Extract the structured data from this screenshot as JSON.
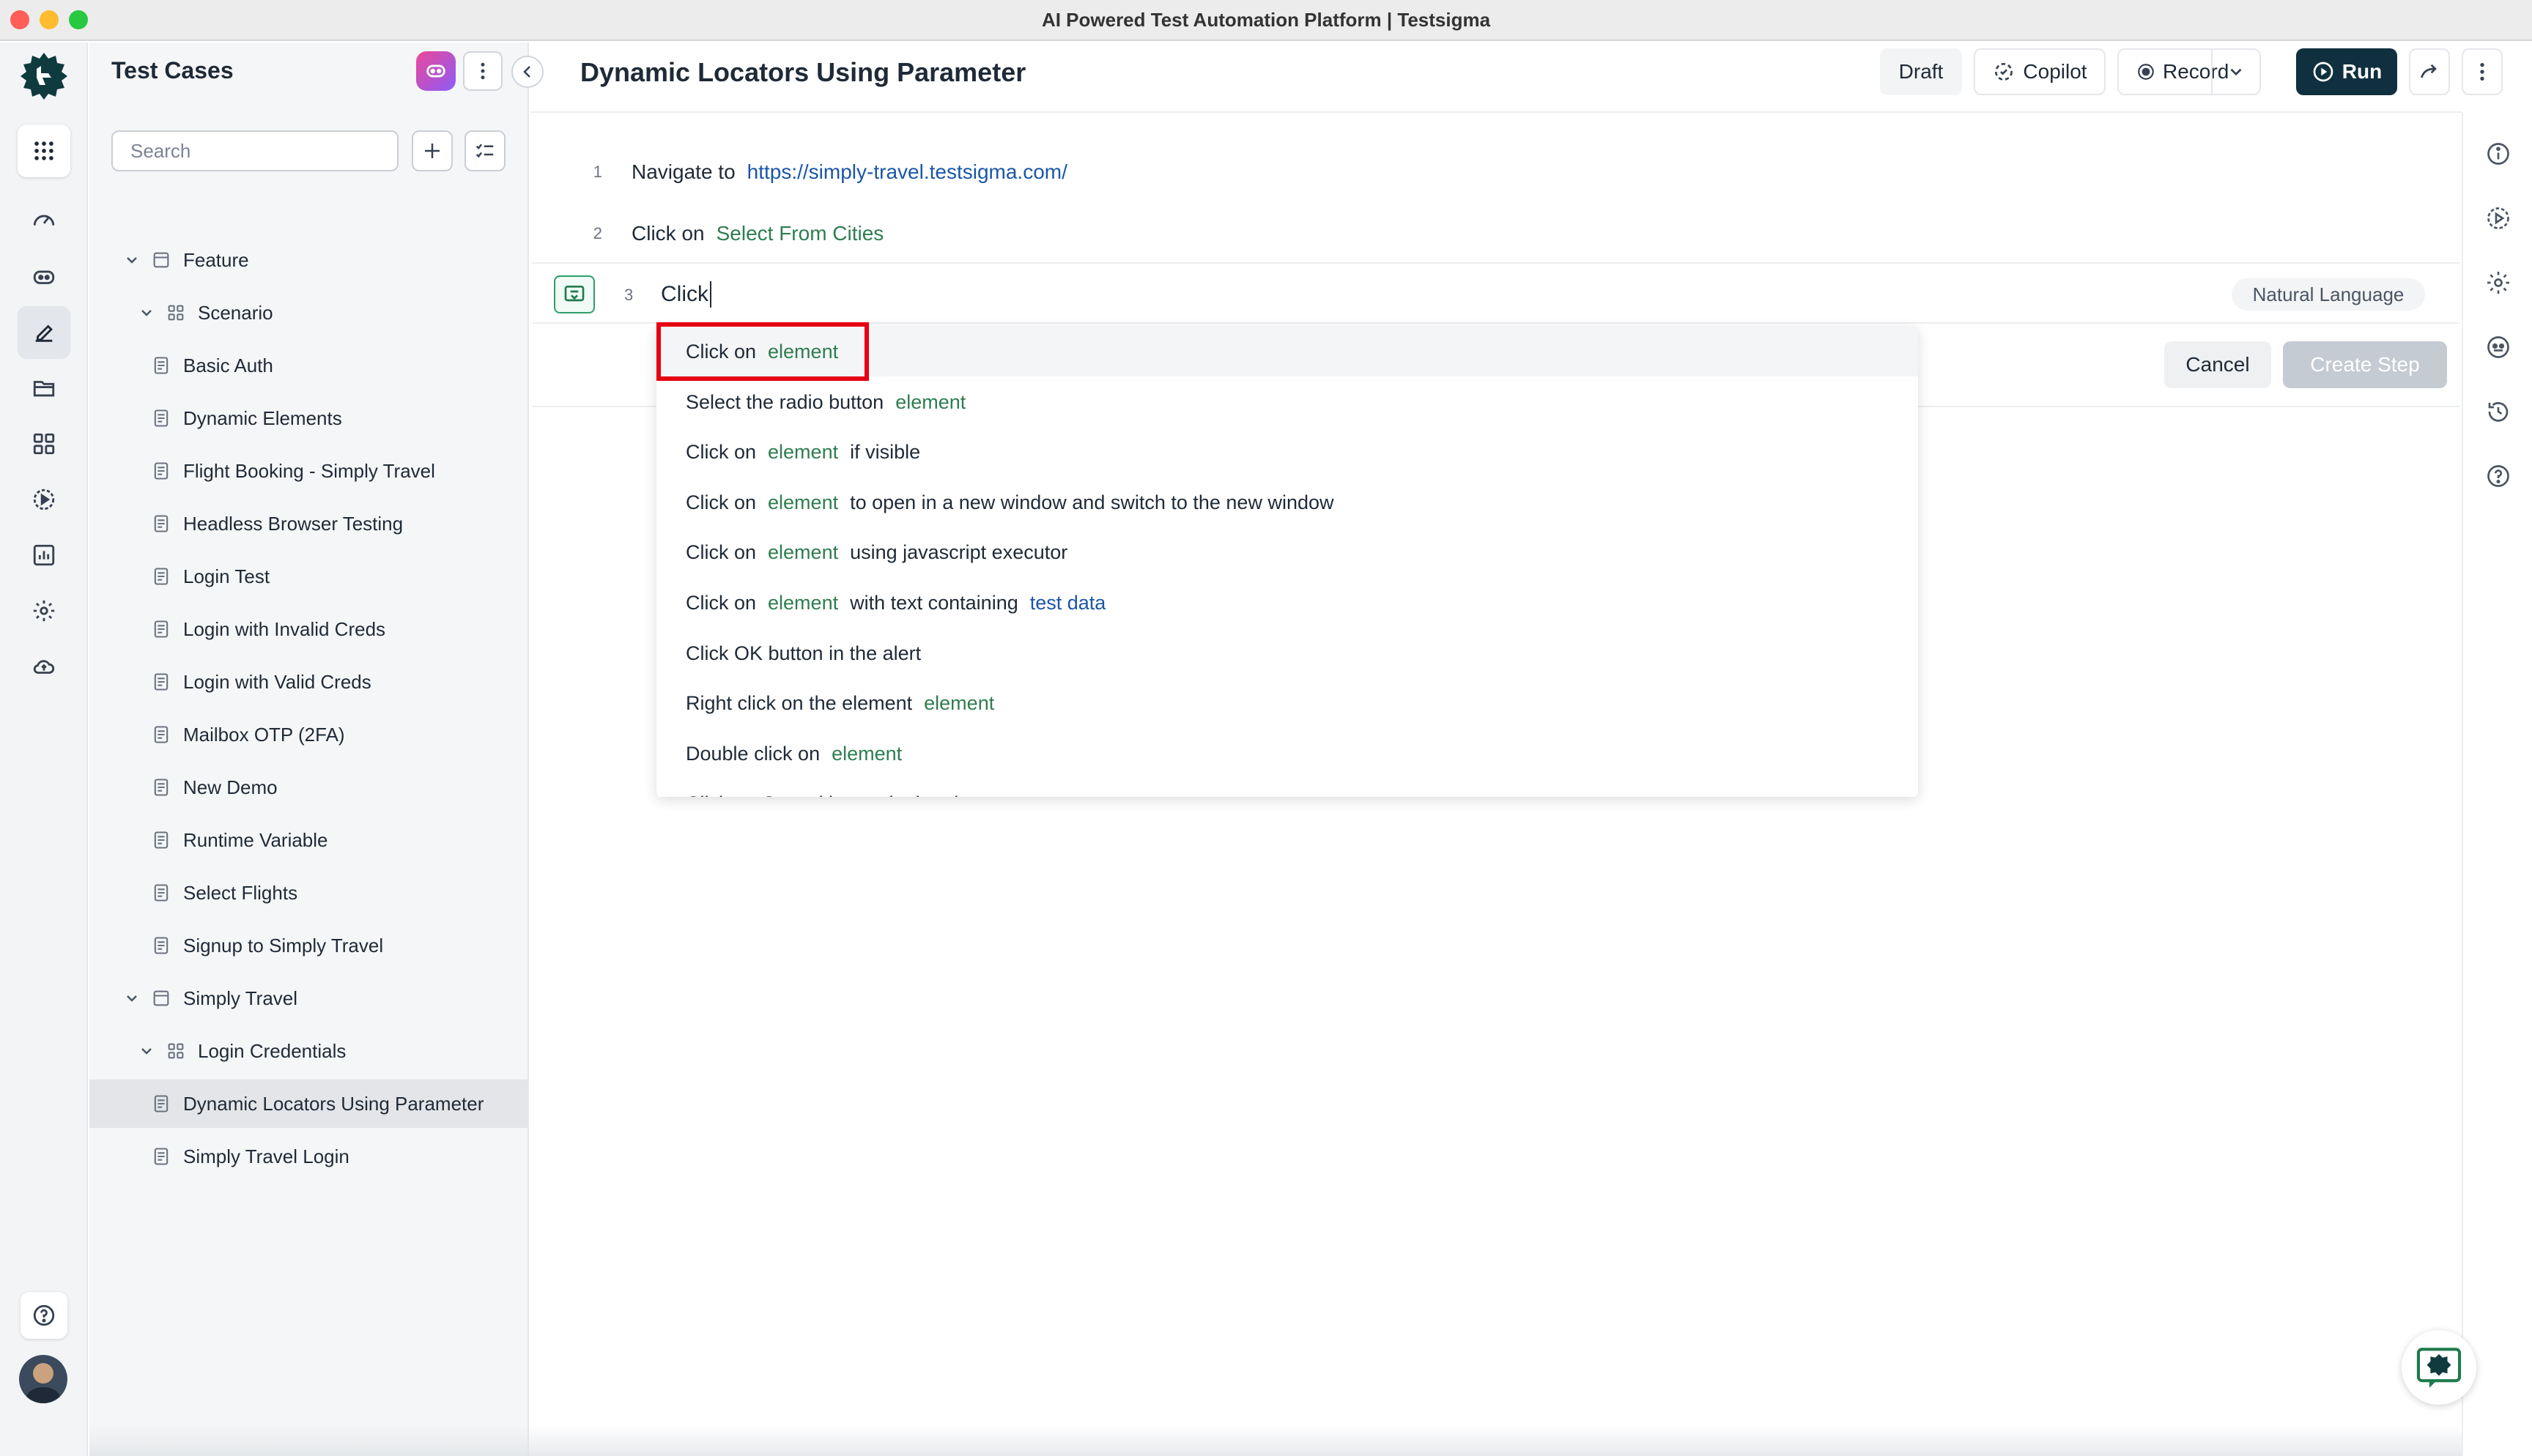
{
  "window": {
    "title": "AI Powered Test Automation Platform | Testsigma"
  },
  "panel": {
    "title": "Test Cases",
    "search_placeholder": "Search",
    "tree": [
      {
        "label": "Feature",
        "level": 0,
        "type": "folder",
        "expanded": true
      },
      {
        "label": "Scenario",
        "level": 1,
        "type": "group",
        "expanded": true
      },
      {
        "label": "Basic Auth",
        "level": 2,
        "type": "case"
      },
      {
        "label": "Dynamic Elements",
        "level": 2,
        "type": "case"
      },
      {
        "label": "Flight Booking - Simply Travel",
        "level": 2,
        "type": "case"
      },
      {
        "label": "Headless Browser Testing",
        "level": 2,
        "type": "case"
      },
      {
        "label": "Login Test",
        "level": 2,
        "type": "case"
      },
      {
        "label": "Login with Invalid Creds",
        "level": 2,
        "type": "case"
      },
      {
        "label": "Login with Valid Creds",
        "level": 2,
        "type": "case"
      },
      {
        "label": "Mailbox OTP (2FA)",
        "level": 2,
        "type": "case"
      },
      {
        "label": "New Demo",
        "level": 2,
        "type": "case"
      },
      {
        "label": "Runtime Variable",
        "level": 2,
        "type": "case"
      },
      {
        "label": "Select Flights",
        "level": 2,
        "type": "case"
      },
      {
        "label": "Signup to Simply Travel",
        "level": 2,
        "type": "case"
      },
      {
        "label": "Simply Travel",
        "level": 0,
        "type": "folder",
        "expanded": true
      },
      {
        "label": "Login Credentials",
        "level": 1,
        "type": "group",
        "expanded": true
      },
      {
        "label": "Dynamic Locators Using Parameter",
        "level": 2,
        "type": "case",
        "selected": true
      },
      {
        "label": "Simply Travel Login",
        "level": 2,
        "type": "case"
      }
    ]
  },
  "header": {
    "title": "Dynamic Locators Using Parameter",
    "draft_label": "Draft",
    "copilot_label": "Copilot",
    "record_label": "Record",
    "run_label": "Run"
  },
  "steps": [
    {
      "num": "1",
      "keyword": "Navigate to",
      "value": "https://simply-travel.testsigma.com/",
      "value_style": "link"
    },
    {
      "num": "2",
      "keyword": "Click on",
      "value": "Select From Cities",
      "value_style": "green"
    }
  ],
  "editor": {
    "num": "3",
    "value": "Click",
    "mode_label": "Natural Language",
    "cancel_label": "Cancel",
    "create_label": "Create Step"
  },
  "suggestions": [
    [
      {
        "t": "Click on",
        "s": "text"
      },
      {
        "t": "element",
        "s": "green"
      }
    ],
    [
      {
        "t": "Select the radio button",
        "s": "text"
      },
      {
        "t": "element",
        "s": "green"
      }
    ],
    [
      {
        "t": "Click on",
        "s": "text"
      },
      {
        "t": "element",
        "s": "green"
      },
      {
        "t": "if visible",
        "s": "text"
      }
    ],
    [
      {
        "t": "Click on",
        "s": "text"
      },
      {
        "t": "element",
        "s": "green"
      },
      {
        "t": "to open in a new window and switch to the new window",
        "s": "text"
      }
    ],
    [
      {
        "t": "Click on",
        "s": "text"
      },
      {
        "t": "element",
        "s": "green"
      },
      {
        "t": "using javascript executor",
        "s": "text"
      }
    ],
    [
      {
        "t": "Click on",
        "s": "text"
      },
      {
        "t": "element",
        "s": "green"
      },
      {
        "t": "with text containing",
        "s": "text"
      },
      {
        "t": "test data",
        "s": "link"
      }
    ],
    [
      {
        "t": "Click OK button in the alert",
        "s": "text"
      }
    ],
    [
      {
        "t": "Right click on the element",
        "s": "text"
      },
      {
        "t": "element",
        "s": "green"
      }
    ],
    [
      {
        "t": "Double click on",
        "s": "text"
      },
      {
        "t": "element",
        "s": "green"
      }
    ],
    [
      {
        "t": "Click on Cancel button in the alert",
        "s": "text"
      }
    ]
  ],
  "colors": {
    "accent_dark": "#10303f",
    "link": "#1a56a8",
    "param_green": "#2e7d4f",
    "highlight_red": "#e60012"
  },
  "icons": {
    "rail": [
      "apps-grid-icon",
      "dashboard-icon",
      "ai-agent-icon",
      "test-cases-pencil-icon",
      "folder-icon",
      "modules-grid-icon",
      "runs-play-icon",
      "reports-chart-icon",
      "settings-gear-icon",
      "cloud-upload-icon",
      "help-icon"
    ],
    "right_rail": [
      "info-icon",
      "run-history-icon",
      "settings-icon",
      "ai-icon",
      "history-icon",
      "help-icon"
    ]
  }
}
